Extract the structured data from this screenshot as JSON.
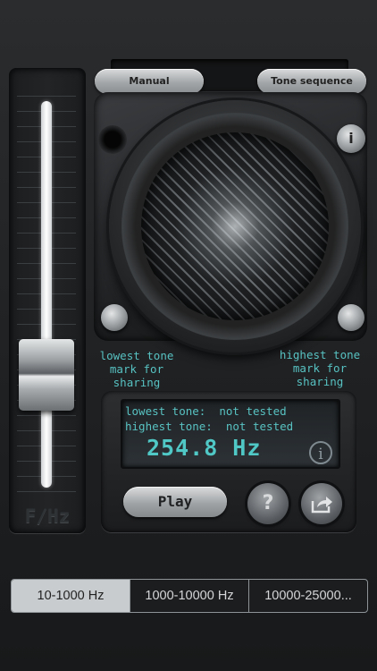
{
  "slider": {
    "axis_label": "F/Hz",
    "position_fraction": 0.24
  },
  "top_buttons": {
    "manual_label": "Manual",
    "tone_sequence_label": "Tone sequence"
  },
  "speaker": {
    "info_label": "i"
  },
  "marks": {
    "lowest_label": "lowest tone\nmark for\nsharing",
    "highest_label": "highest tone\nmark for\nsharing"
  },
  "display": {
    "lowest_line": "lowest tone:  not tested",
    "highest_line": "highest tone:  not tested",
    "frequency": "254.8 Hz",
    "info_label": "i"
  },
  "controls": {
    "play_label": "Play",
    "help_label": "?"
  },
  "ranges": {
    "items": [
      "10-1000 Hz",
      "1000-10000 Hz",
      "10000-25000..."
    ],
    "selected_index": 0
  },
  "colors": {
    "lcd_text": "#58c2c2",
    "background": "#1e2022"
  },
  "icons": {
    "share": "share-icon",
    "help": "question-icon",
    "info": "info-icon"
  }
}
